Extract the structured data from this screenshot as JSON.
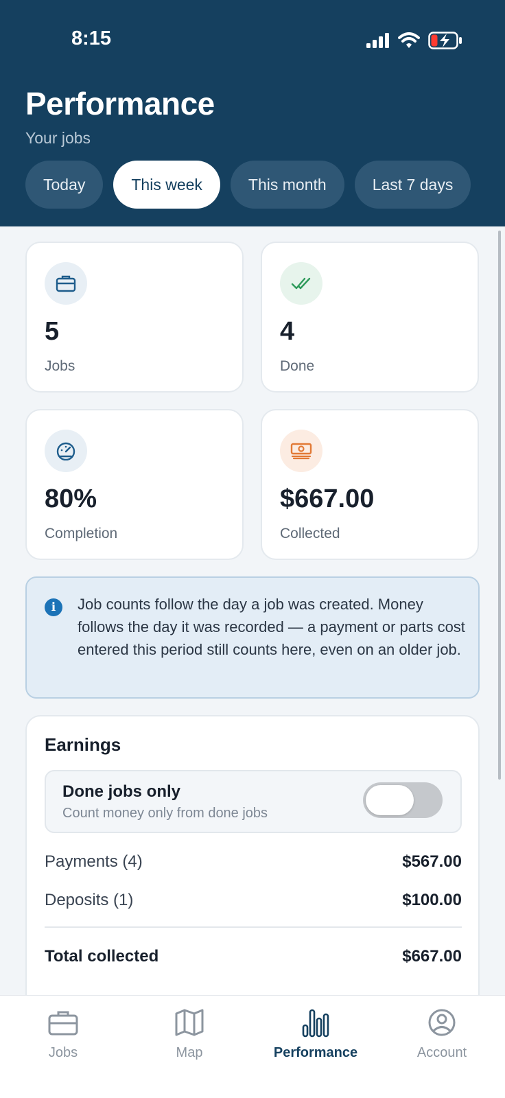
{
  "status_bar": {
    "time": "8:15"
  },
  "header": {
    "title": "Performance",
    "subtitle": "Your jobs"
  },
  "tabs": [
    {
      "label": "Today",
      "active": false
    },
    {
      "label": "This week",
      "active": true
    },
    {
      "label": "This month",
      "active": false
    },
    {
      "label": "Last 7 days",
      "active": false
    }
  ],
  "stats": [
    {
      "icon": "briefcase-icon",
      "value": "5",
      "label": "Jobs",
      "color": "#1e5d8c",
      "bg": "#e8eff5"
    },
    {
      "icon": "double-check-icon",
      "value": "4",
      "label": "Done",
      "color": "#2e9a5a",
      "bg": "#e7f4ec"
    },
    {
      "icon": "gauge-icon",
      "value": "80%",
      "label": "Completion",
      "color": "#1e5d8c",
      "bg": "#e8eff5"
    },
    {
      "icon": "banknote-icon",
      "value": "$667.00",
      "label": "Collected",
      "color": "#e27a36",
      "bg": "#fcece2"
    }
  ],
  "info": {
    "icon": "info-icon",
    "text": "Job counts follow the day a job was created. Money follows the day it was recorded — a payment or parts cost entered this period still counts here, even on an older job."
  },
  "earnings": {
    "title": "Earnings",
    "toggle": {
      "title": "Done jobs only",
      "subtitle": "Count money only from done jobs",
      "on": false
    },
    "rows": [
      {
        "label": "Payments (4)",
        "value": "$567.00"
      },
      {
        "label": "Deposits (1)",
        "value": "$100.00"
      }
    ],
    "total": {
      "label": "Total collected",
      "value": "$667.00"
    }
  },
  "nav": [
    {
      "label": "Jobs",
      "icon": "briefcase-icon",
      "active": false
    },
    {
      "label": "Map",
      "icon": "map-icon",
      "active": false
    },
    {
      "label": "Performance",
      "icon": "bar-chart-icon",
      "active": true
    },
    {
      "label": "Account",
      "icon": "account-icon",
      "active": false
    }
  ],
  "colors": {
    "header": "#15405f",
    "accent": "#15405f"
  }
}
